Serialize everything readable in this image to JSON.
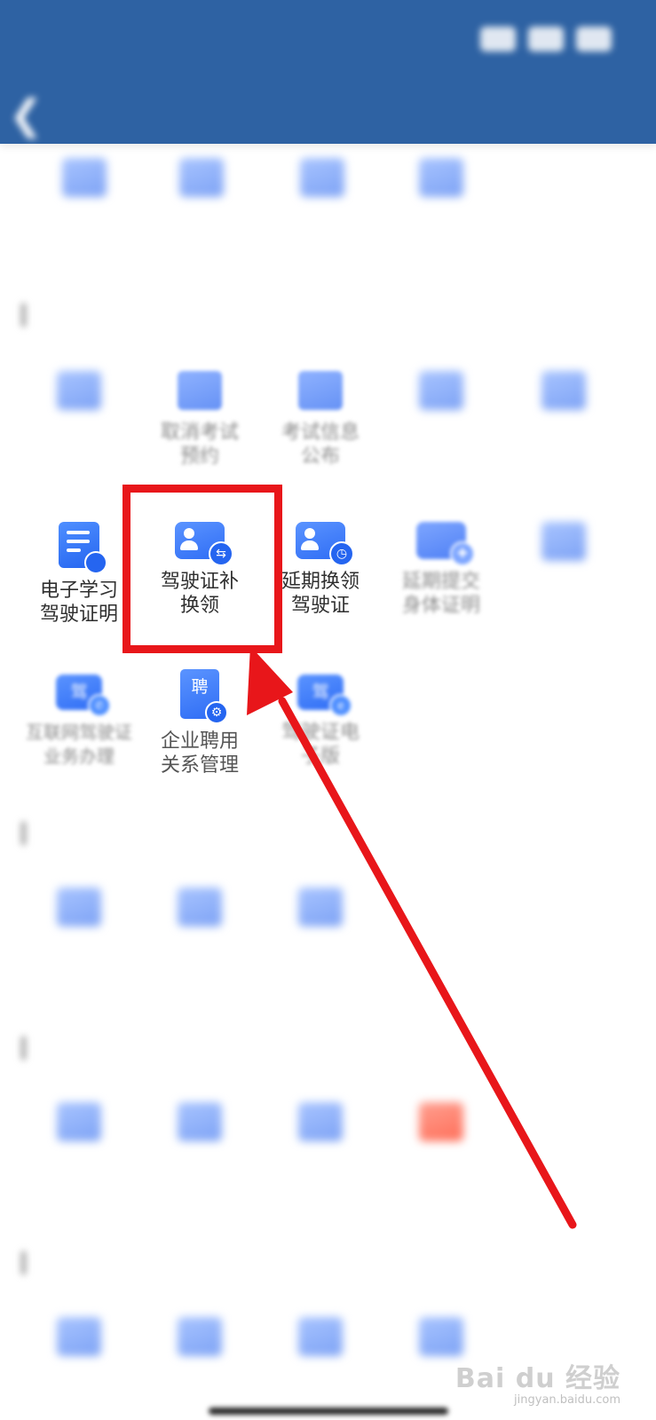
{
  "status_bar": {
    "time": ""
  },
  "header": {
    "back_label": "",
    "title": ""
  },
  "sections": [
    {
      "title": ""
    },
    {
      "title": ""
    },
    {
      "title": ""
    },
    {
      "title": ""
    }
  ],
  "visible_items": {
    "cancel_exam": "取消考试\n预约",
    "exam_info": "考试信息\n公布",
    "e_study_cert": "电子学习\n驾驶证明",
    "license_replace": "驾驶证补\n换领",
    "extend_renew": "延期换领\n驾驶证",
    "extend_health": "延期提交\n身体证明",
    "remote_license": "互联网驾驶证\n业务办理",
    "company_hire": "企业聘用\n关系管理",
    "license_e": "驾驶证电\n子版"
  },
  "icons": {
    "pin_char": "聘",
    "jia_char": "驾"
  },
  "watermark": {
    "logo": "Bai du 经验",
    "url": "jingyan.baidu.com"
  },
  "colors": {
    "header": "#2e62a3",
    "icon_blue": "#2f6df5",
    "highlight_red": "#e8161a"
  }
}
